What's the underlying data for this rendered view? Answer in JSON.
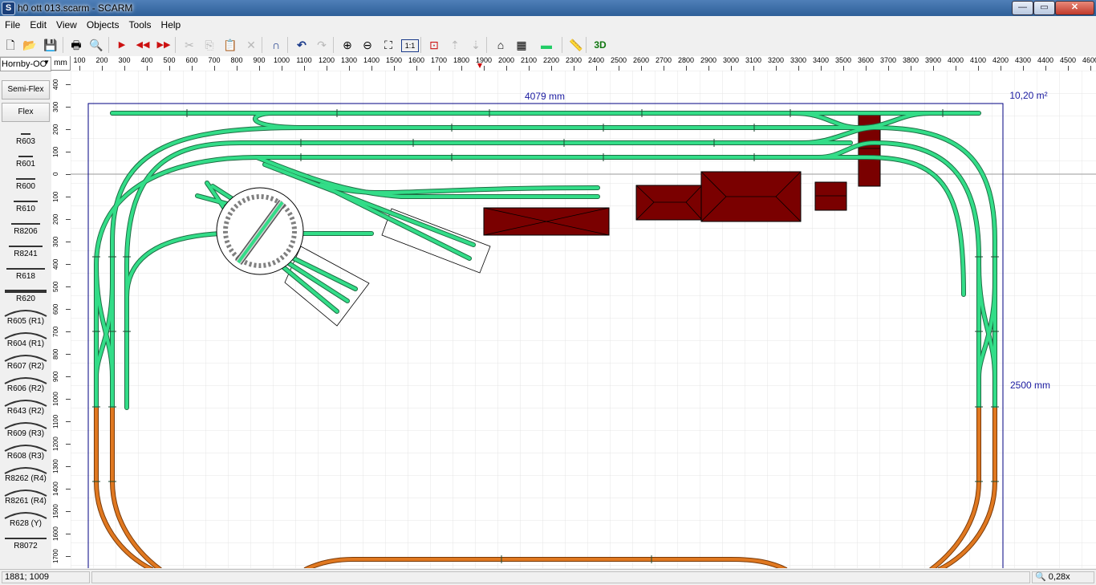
{
  "window": {
    "title": "h0 ott 013.scarm - SCARM",
    "app_icon": "S",
    "minimize": "—",
    "maximize": "▭",
    "close": "✕"
  },
  "menu": [
    "File",
    "Edit",
    "View",
    "Objects",
    "Tools",
    "Help"
  ],
  "toolbar": [
    {
      "name": "new-file-icon",
      "glyph": "🗋",
      "enabled": true
    },
    {
      "name": "open-folder-icon",
      "glyph": "📂",
      "enabled": true
    },
    {
      "name": "save-icon",
      "glyph": "💾",
      "enabled": true
    },
    {
      "name": "print-icon",
      "glyph": "🖶",
      "enabled": true
    },
    {
      "name": "print-preview-icon",
      "glyph": "🔍",
      "enabled": true
    },
    {
      "name": "play-forward-icon",
      "glyph": "▶",
      "enabled": true
    },
    {
      "name": "rewind-icon",
      "glyph": "◀◀",
      "enabled": true
    },
    {
      "name": "fast-forward-icon",
      "glyph": "▶▶",
      "enabled": true
    },
    {
      "name": "cut-icon",
      "glyph": "✂",
      "enabled": false
    },
    {
      "name": "copy-icon",
      "glyph": "⎘",
      "enabled": false
    },
    {
      "name": "paste-icon",
      "glyph": "📋",
      "enabled": false
    },
    {
      "name": "delete-icon",
      "glyph": "✕",
      "enabled": false
    },
    {
      "name": "magnet-icon",
      "glyph": "∩",
      "enabled": true
    },
    {
      "name": "undo-icon",
      "glyph": "↶",
      "enabled": true
    },
    {
      "name": "redo-icon",
      "glyph": "↷",
      "enabled": false
    },
    {
      "name": "zoom-in-icon",
      "glyph": "⊕",
      "enabled": true
    },
    {
      "name": "zoom-out-icon",
      "glyph": "⊖",
      "enabled": true
    },
    {
      "name": "fit-all-icon",
      "glyph": "⛶",
      "enabled": true
    },
    {
      "name": "zoom-1-1-icon",
      "glyph": "1:1",
      "enabled": true
    },
    {
      "name": "track-end-icon",
      "glyph": "⊡",
      "enabled": true
    },
    {
      "name": "raise-track-icon",
      "glyph": "⇡",
      "enabled": false
    },
    {
      "name": "lower-track-icon",
      "glyph": "⇣",
      "enabled": false
    },
    {
      "name": "tunnel-icon",
      "glyph": "⌂",
      "enabled": true
    },
    {
      "name": "chip-icon",
      "glyph": "▦",
      "enabled": true
    },
    {
      "name": "track-color-icon",
      "glyph": "▬",
      "enabled": true
    },
    {
      "name": "measure-icon",
      "glyph": "📏",
      "enabled": true
    },
    {
      "name": "view-3d-icon",
      "glyph": "3D",
      "enabled": true
    }
  ],
  "library": {
    "selected": "Hornby-OO",
    "buttons": [
      "Semi-Flex",
      "Flex"
    ],
    "items": [
      "R603",
      "R601",
      "R600",
      "R610",
      "R8206",
      "R8241",
      "R618",
      "R620",
      "R605 (R1)",
      "R604 (R1)",
      "R607 (R2)",
      "R606 (R2)",
      "R643 (R2)",
      "R609 (R3)",
      "R608 (R3)",
      "R8262 (R4)",
      "R8261 (R4)",
      "R628 (Y)",
      "R8072"
    ]
  },
  "ruler": {
    "unit_label": "mm",
    "top_ticks": [
      "100",
      "200",
      "300",
      "400",
      "500",
      "600",
      "700",
      "800",
      "900",
      "1000",
      "1100",
      "1200",
      "1300",
      "1400",
      "1500",
      "1600",
      "1700",
      "1800",
      "1900",
      "2000",
      "2100",
      "2200",
      "2300",
      "2400",
      "2500",
      "2600",
      "2700",
      "2800",
      "2900",
      "3000",
      "3100",
      "3200",
      "3300",
      "3400",
      "3500",
      "3600",
      "3700",
      "3800",
      "3900",
      "4000",
      "4100",
      "4200",
      "4300",
      "4400",
      "4500",
      "4600"
    ],
    "left_ticks": [
      "400",
      "300",
      "200",
      "100",
      "0",
      "100",
      "200",
      "300",
      "400",
      "500",
      "600",
      "700",
      "800",
      "900",
      "1000",
      "1100",
      "1200",
      "1300",
      "1400",
      "1500",
      "1600",
      "1700"
    ]
  },
  "layout": {
    "width_label": "4079 mm",
    "height_label": "2500 mm",
    "area_label": "10,20 m²"
  },
  "colors": {
    "track_green": "#33dd88",
    "track_orange": "#e07820",
    "building": "#7a0000",
    "board_outline": "#000080",
    "dimension_text": "#1a1aa0"
  },
  "status": {
    "coords": "1881; 1009",
    "zoom": "0,28x"
  }
}
